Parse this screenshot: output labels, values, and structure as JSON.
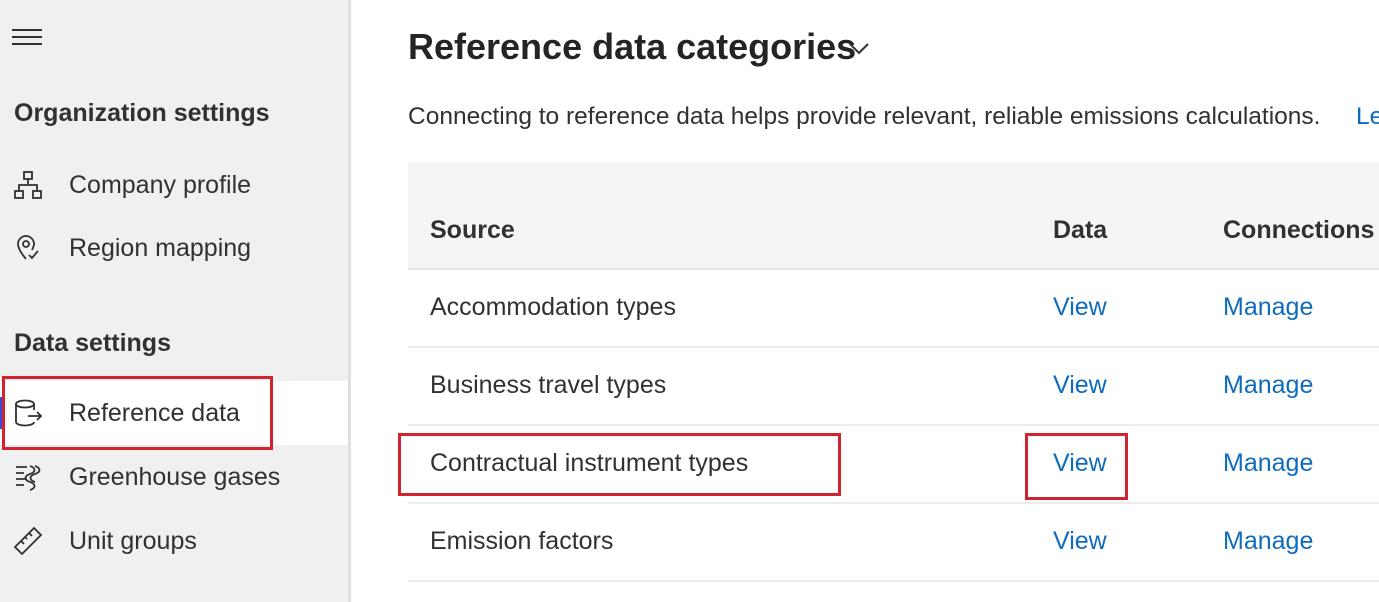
{
  "sidebar": {
    "org_section_title": "Organization settings",
    "data_section_title": "Data settings",
    "items": [
      {
        "label": "Company profile",
        "icon": "org-chart-icon"
      },
      {
        "label": "Region mapping",
        "icon": "location-pin-icon"
      },
      {
        "label": "Reference data",
        "icon": "database-export-icon",
        "selected": true
      },
      {
        "label": "Greenhouse gases",
        "icon": "gas-layers-icon"
      },
      {
        "label": "Unit groups",
        "icon": "ruler-icon"
      }
    ]
  },
  "main": {
    "title": "Reference data categories",
    "description": "Connecting to reference data helps provide relevant, reliable emissions calculations.",
    "learn_more_link": "Le",
    "table": {
      "headers": [
        "Source",
        "Data",
        "Connections"
      ],
      "rows": [
        {
          "source": "Accommodation types",
          "data": "View",
          "connections": "Manage"
        },
        {
          "source": "Business travel types",
          "data": "View",
          "connections": "Manage"
        },
        {
          "source": "Contractual instrument types",
          "data": "View",
          "connections": "Manage"
        },
        {
          "source": "Emission factors",
          "data": "View",
          "connections": "Manage"
        }
      ]
    }
  },
  "colors": {
    "link": "#0f6cbd",
    "selection_indicator": "#3b4bd4",
    "callout_border": "#d1242f",
    "sidebar_bg": "#f0f0f0"
  }
}
